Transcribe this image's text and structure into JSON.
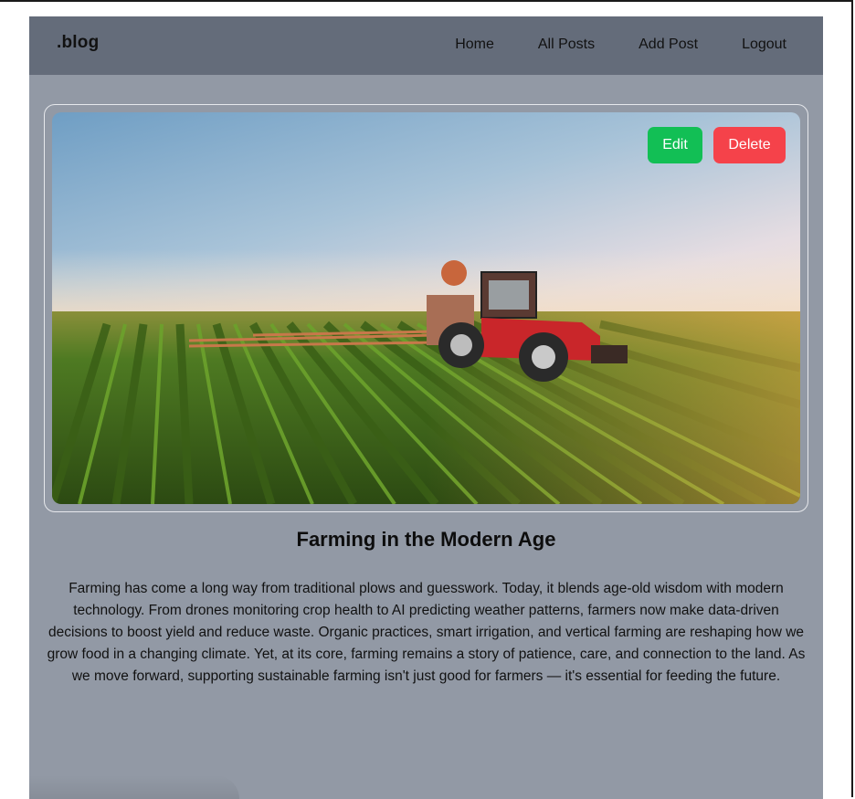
{
  "header": {
    "brand": ".blog",
    "nav": [
      {
        "label": "Home"
      },
      {
        "label": "All Posts"
      },
      {
        "label": "Add Post"
      },
      {
        "label": "Logout"
      }
    ]
  },
  "post": {
    "image_subject": "tractor-field-photo",
    "actions": {
      "edit_label": "Edit",
      "delete_label": "Delete"
    },
    "title": "Farming in the Modern Age",
    "body": "Farming has come a long way from traditional plows and guesswork. Today, it blends age-old wisdom with modern technology. From drones monitoring crop health to AI predicting weather patterns, farmers now make data-driven decisions to boost yield and reduce waste. Organic practices, smart irrigation, and vertical farming are reshaping how we grow food in a changing climate. Yet, at its core, farming remains a story of patience, care, and connection to the land. As we move forward, supporting sustainable farming isn't just good for farmers — it's essential for feeding the future."
  },
  "colors": {
    "page_bg": "#9299a5",
    "navbar_bg": "#646c7a",
    "edit_button": "#12bf55",
    "delete_button": "#f5424a"
  }
}
